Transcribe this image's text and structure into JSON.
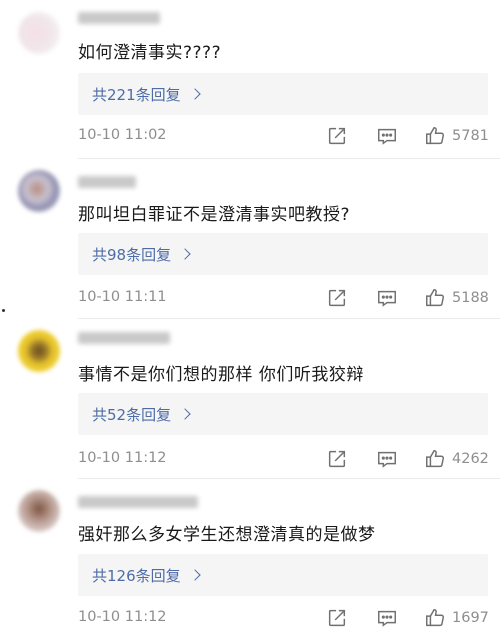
{
  "comments": [
    {
      "text": "如何澄清事实????",
      "replies_label": "共221条回复",
      "timestamp": "10-10 11:02",
      "likes": "5781"
    },
    {
      "text": "那叫坦白罪证不是澄清事实吧教授?",
      "replies_label": "共98条回复",
      "timestamp": "10-10 11:11",
      "likes": "5188"
    },
    {
      "text": "事情不是你们想的那样  你们听我狡辩",
      "replies_label": "共52条回复",
      "timestamp": "10-10 11:12",
      "likes": "4262"
    },
    {
      "text": "强奸那么多女学生还想澄清真的是做梦",
      "replies_label": "共126条回复",
      "timestamp": "10-10 11:12",
      "likes": "1697"
    }
  ],
  "icons": {
    "forward": "share-edit-icon",
    "reply": "comment-icon",
    "like": "thumbs-up-icon"
  },
  "colors": {
    "link": "#4d6ca7",
    "meta": "#8e8e8e",
    "reply_bg": "#f5f5f5"
  }
}
